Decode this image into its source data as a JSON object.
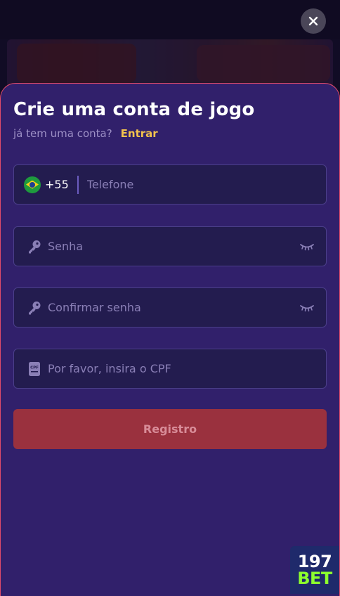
{
  "background": {
    "nav_items": [
      "",
      "",
      "",
      ""
    ],
    "brand_colors": {
      "page": "#1c1436",
      "sheet": "#31206b",
      "sheet_border": "#e14a6a"
    }
  },
  "modal": {
    "title": "Crie uma conta de jogo",
    "subtitle": "já tem uma conta?",
    "login_link": "Entrar",
    "phone": {
      "country_code": "+55",
      "flag_icon": "brazil-flag-icon",
      "placeholder": "Telefone",
      "value": ""
    },
    "password": {
      "placeholder": "Senha",
      "value": "",
      "lead_icon": "key-icon",
      "toggle_icon": "eye-closed-icon"
    },
    "confirm_password": {
      "placeholder": "Confirmar senha",
      "value": "",
      "lead_icon": "key-icon",
      "toggle_icon": "eye-closed-icon"
    },
    "cpf": {
      "placeholder": "Por favor, insira o CPF",
      "value": "",
      "lead_icon": "cpf-card-icon",
      "icon_text": "CPF"
    },
    "register_button": "Registro",
    "accent_link_color": "#f2c24d",
    "button_color": "#9a313e"
  },
  "close_icon": "close-icon",
  "brand_badge": {
    "top": "197",
    "bottom": "BET",
    "bottom_color": "#8cff2e"
  }
}
